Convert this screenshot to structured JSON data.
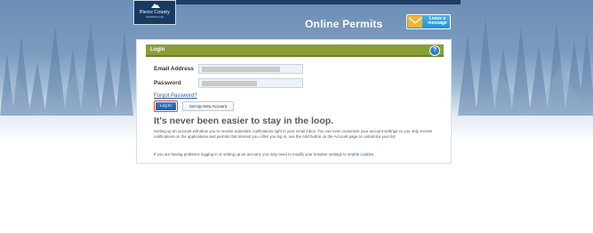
{
  "header": {
    "logo_text": "Pierce County",
    "logo_subtext": "WASHINGTON",
    "app_title": "Online Permits",
    "message_button_label": "Leave a message"
  },
  "login_panel": {
    "title": "Login",
    "email_label": "Email Address",
    "password_label": "Password",
    "forgot_link": "Forgot Password?",
    "login_button": "Log In",
    "setup_button": "Set Up New Account"
  },
  "promo": {
    "headline": "It's never been easier to stay in the loop.",
    "paragraph1": "Setting up an account will allow you to receive automatic notifications right in your email inbox. You can even customize your account settings so you only receive notifications on the applications and permits that interest you. After you log in, use the Add button on the Account page to customize your list.",
    "paragraph2_prefix": "If you are having problems logging in or setting up an account, you may need to modify your browser settings to ",
    "paragraph2_link": "enable cookies",
    "paragraph2_suffix": "."
  },
  "colors": {
    "panel_header": "#8a9e38",
    "login_button": "#225fa8",
    "highlight_outline": "#e8412b",
    "message_button": "#2790d6",
    "logo_background": "#173a63"
  }
}
